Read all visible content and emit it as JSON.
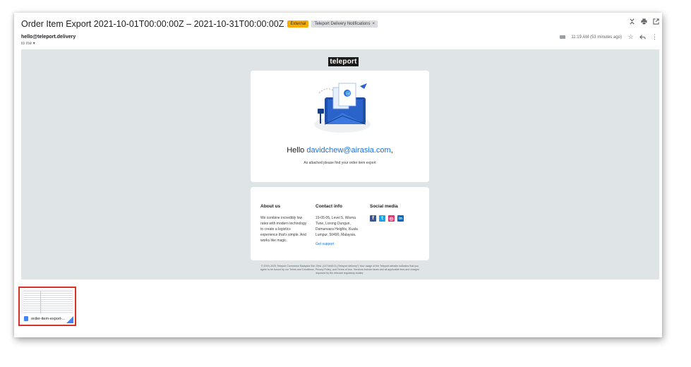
{
  "email": {
    "subject": "Order Item Export 2021-10-01T00:00:00Z – 2021-10-31T00:00:00Z",
    "badge_external": "External",
    "label_tag": "Teleport Delivery Notifications",
    "label_close": "×",
    "sender": "hello@teleport.delivery",
    "to": "to me",
    "time": "11:19 AM (53 minutes ago)"
  },
  "icons": {
    "expand": "expand-icon",
    "print": "print-icon",
    "open_new": "open-in-new-icon",
    "star": "star-icon",
    "reply": "reply-icon",
    "more": "more-vert-icon"
  },
  "body": {
    "logo": "teleport",
    "hello_prefix": "Hello ",
    "hello_email": "davidchew@airasia.com",
    "hello_suffix": ",",
    "note": "As attached please find your order item export",
    "about_title": "About us",
    "about_text": "We combine incredibly low rates with modern technology to create a logistics experience that's simple. And works like magic.",
    "contact_title": "Contact info",
    "contact_text": "19-05-05, Level 5, Wisma Tune, Lorong Dungun, Damansara Heights, Kuala Lumpur, 50490, Malaysia.",
    "contact_link": "Get support",
    "social_title": "Social media",
    "social": [
      {
        "name": "facebook-icon",
        "glyph": "f",
        "color": "#3b5998"
      },
      {
        "name": "twitter-icon",
        "glyph": "t",
        "color": "#1da1f2"
      },
      {
        "name": "instagram-icon",
        "glyph": "◎",
        "color": "#e1306c"
      },
      {
        "name": "linkedin-icon",
        "glyph": "in",
        "color": "#0a66c2"
      }
    ],
    "legal": "© 2019–2021 Teleport Commerce Malaysia Sdn. Bhd. (1271640-D) (\"teleport delivery\") Your usage of the Teleport website indicates that you agree to be bound by our Terms and Conditions, Privacy Policy, and Terms of Use. Services include taxes and all applicable fees and charges imposed by the relevant regulatory bodies."
  },
  "attachment": {
    "file_name": "order-item-export-..."
  },
  "colors": {
    "accent": "#1a73e8",
    "external_badge": "#f9ab00",
    "highlight_border": "#d93025"
  }
}
